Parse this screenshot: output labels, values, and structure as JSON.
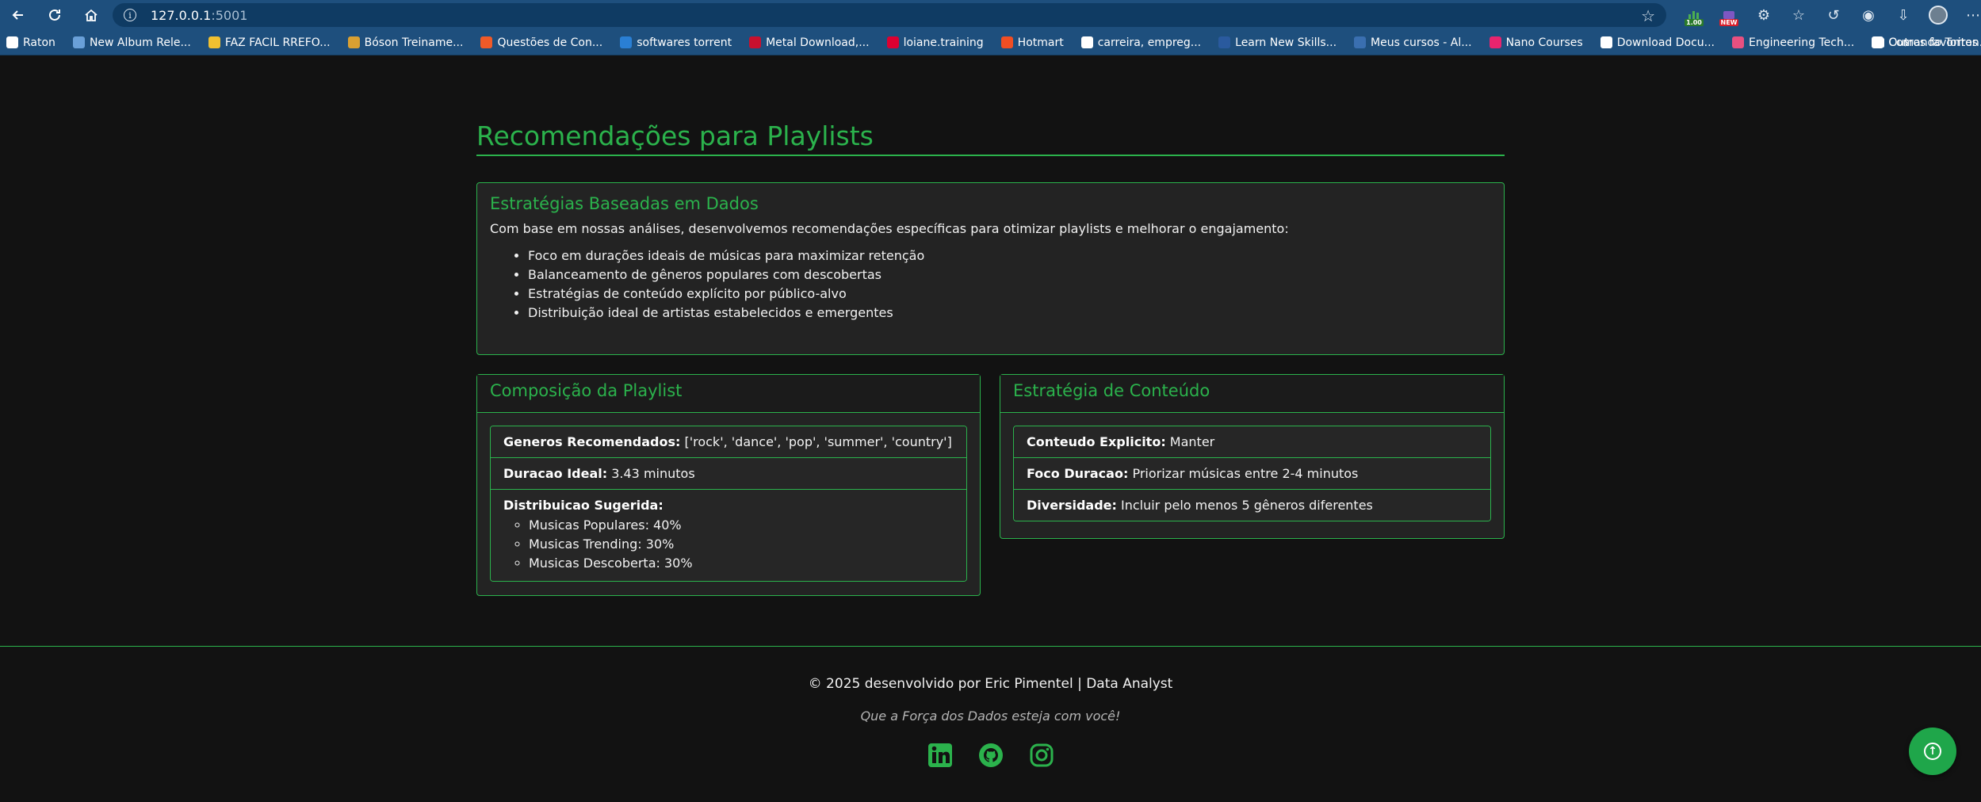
{
  "browser": {
    "url_host": "127.0.0.1",
    "url_port": ":5001",
    "ext_badges": [
      "1.00",
      "NEW"
    ],
    "bookmarks": [
      {
        "label": "Raton",
        "icon": "raton-icon",
        "color": "#ffffff"
      },
      {
        "label": "New Album Rele...",
        "icon": "album-icon",
        "color": "#6aa0d8"
      },
      {
        "label": "FAZ FACIL RREFO...",
        "icon": "faz-icon",
        "color": "#f0c030"
      },
      {
        "label": "Bóson Treiname...",
        "icon": "boson-icon",
        "color": "#d9a032"
      },
      {
        "label": "Questões de Con...",
        "icon": "questoes-icon",
        "color": "#f05a28"
      },
      {
        "label": "softwares torrent",
        "icon": "chart-icon",
        "color": "#2a7fd4"
      },
      {
        "label": "Metal Download,...",
        "icon": "metal-icon",
        "color": "#c8102e"
      },
      {
        "label": "loiane.training",
        "icon": "angular-icon",
        "color": "#dd0031"
      },
      {
        "label": "Hotmart",
        "icon": "hotmart-icon",
        "color": "#f04e23"
      },
      {
        "label": "carreira, empreg...",
        "icon": "b-icon",
        "color": "#ffffff"
      },
      {
        "label": "Learn New Skills...",
        "icon": "learn-icon",
        "color": "#2a5a9e"
      },
      {
        "label": "Meus cursos - Al...",
        "icon": "cursos-icon",
        "color": "#3a6fb0"
      },
      {
        "label": "Nano Courses",
        "icon": "nano-icon",
        "color": "#e8246e"
      },
      {
        "label": "Download Docu...",
        "icon": "doc-icon",
        "color": "#ffffff"
      },
      {
        "label": "Engineering Tech...",
        "icon": "eng-icon",
        "color": "#e85080"
      },
      {
        "label": "Comando Torren...",
        "icon": "doc-icon",
        "color": "#ffffff"
      }
    ],
    "others_label": "Outros favoritos"
  },
  "page": {
    "title": "Recomendações para Playlists",
    "intro": {
      "heading": "Estratégias Baseadas em Dados",
      "text": "Com base em nossas análises, desenvolvemos recomendações específicas para otimizar playlists e melhorar o engajamento:",
      "items": [
        "Foco em durações ideais de músicas para maximizar retenção",
        "Balanceamento de gêneros populares com descobertas",
        "Estratégias de conteúdo explícito por público-alvo",
        "Distribuição ideal de artistas estabelecidos e emergentes"
      ]
    },
    "composition": {
      "heading": "Composição da Playlist",
      "genres_label": "Generos Recomendados:",
      "genres_value": " ['rock', 'dance', 'pop', 'summer', 'country']",
      "duration_label": "Duracao Ideal:",
      "duration_value": " 3.43 minutos",
      "distribution_label": "Distribuicao Sugerida:",
      "distribution": [
        "Musicas Populares: 40%",
        "Musicas Trending: 30%",
        "Musicas Descoberta: 30%"
      ]
    },
    "strategy": {
      "heading": "Estratégia de Conteúdo",
      "explicit_label": "Conteudo Explicito:",
      "explicit_value": " Manter",
      "focus_label": "Foco Duracao:",
      "focus_value": " Priorizar músicas entre 2-4 minutos",
      "diversity_label": "Diversidade:",
      "diversity_value": " Incluir pelo menos 5 gêneros diferentes"
    }
  },
  "footer": {
    "credit": "© 2025 desenvolvido por Eric Pimentel | Data Analyst",
    "quote": "Que a Força dos Dados esteja com você!",
    "socials": [
      "linkedin-icon",
      "github-icon",
      "instagram-icon"
    ]
  },
  "colors": {
    "accent": "#2bb24c",
    "background": "#121212",
    "card": "#232323",
    "chrome": "#1e4f7d"
  }
}
